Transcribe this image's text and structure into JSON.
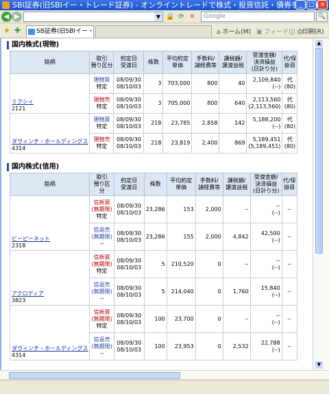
{
  "window": {
    "title": "SBI証券(旧SBIイー・トレード証券) - オンライントレードで株式・投資信託・債券を - Win..."
  },
  "nav": {
    "address": "",
    "search_placeholder": "Google"
  },
  "tabs": {
    "active": "SB証券(旧SBIイー・トレ...",
    "second": "",
    "home": "ホーム(M)",
    "feed": "フィード(J)",
    "print": "印刷(R)"
  },
  "genbutsu": {
    "title": "国内株式(現物)",
    "headers": [
      "銘柄",
      "取引\n預り区分",
      "約定日\n受渡日",
      "株数",
      "平均約定\n単価",
      "手数料/\n諸経費等",
      "課税額/\n譲渡益税",
      "受渡金額/\n決済損益\n(日計り分)",
      "代/保\n掛目"
    ],
    "rows": [
      {
        "name": "ミクシィ",
        "code": "2121",
        "side": "現物買",
        "sub": "特定",
        "trade": "08/09/30",
        "settle": "08/10/03",
        "qty": "3",
        "price": "703,000",
        "fee": "800",
        "tax": "40",
        "amount": "2,109,840",
        "pl": "(--)",
        "dai": "代",
        "kake": "(80)"
      },
      {
        "name": "",
        "code": "",
        "side": "現物売",
        "sub": "特定",
        "trade": "08/09/30",
        "settle": "08/10/03",
        "qty": "3",
        "price": "705,000",
        "fee": "800",
        "tax": "640",
        "amount": "2,113,560",
        "pl": "(2,113,560)",
        "dai": "代",
        "kake": "(80)"
      },
      {
        "name": "ダヴィンチ・ホールディングス",
        "code": "4314",
        "side": "現物買",
        "sub": "特定",
        "trade": "08/09/30",
        "settle": "08/10/03",
        "qty": "218",
        "price": "23,785",
        "fee": "2,858",
        "tax": "142",
        "amount": "5,188,200",
        "pl": "(--)",
        "dai": "代",
        "kake": "(80)"
      },
      {
        "name": "",
        "code": "",
        "side": "現物売",
        "sub": "特定",
        "trade": "08/09/30",
        "settle": "08/10/03",
        "qty": "218",
        "price": "23,819",
        "fee": "2,400",
        "tax": "869",
        "amount": "5,189,451",
        "pl": "(5,189,451)",
        "dai": "代",
        "kake": "(80)"
      }
    ]
  },
  "shinyo": {
    "title": "国内株式(信用)",
    "headers": [
      "銘柄",
      "取引\n預り区\n分",
      "約定日\n受渡日",
      "株数",
      "平均約定\n単価",
      "手数料/\n諸経費等",
      "課税額/\n譲渡益税",
      "受渡金額/\n決済損益\n(日計り分)",
      "代/保\n掛目"
    ],
    "rows": [
      {
        "name": "ビーピーネット",
        "code": "2318",
        "side": "信新買",
        "kind": "(無期限)",
        "sub": "特定",
        "trade": "08/09/30",
        "settle": "08/10/03",
        "qty": "23,286",
        "price": "153",
        "fee": "2,000",
        "tax": "--",
        "amount": "--",
        "pl": "(--)",
        "kake": "--"
      },
      {
        "name": "",
        "code": "",
        "side": "信返売",
        "kind": "(無期限)",
        "sub": "--",
        "trade": "08/09/30",
        "settle": "08/10/03",
        "qty": "23,286",
        "price": "155",
        "fee": "2,000",
        "tax": "4,842",
        "amount": "42,500",
        "pl": "(--)",
        "kake": "--"
      },
      {
        "name": "アクロディア",
        "code": "3823",
        "side": "信新買",
        "kind": "(無期限)",
        "sub": "特定",
        "trade": "08/09/30",
        "settle": "08/10/03",
        "qty": "5",
        "price": "210,520",
        "fee": "0",
        "tax": "--",
        "amount": "--",
        "pl": "(--)",
        "kake": "--"
      },
      {
        "name": "",
        "code": "",
        "side": "信返売",
        "kind": "(無期限)",
        "sub": "--",
        "trade": "08/09/30",
        "settle": "08/10/03",
        "qty": "5",
        "price": "214,040",
        "fee": "0",
        "tax": "1,760",
        "amount": "15,840",
        "pl": "(--)",
        "kake": "--"
      },
      {
        "name": "ダヴィンチ・ホールディングス",
        "code": "4314",
        "side": "信新買",
        "kind": "(無期限)",
        "sub": "特定",
        "trade": "08/09/30",
        "settle": "08/10/03",
        "qty": "100",
        "price": "23,700",
        "fee": "0",
        "tax": "--",
        "amount": "--",
        "pl": "(--)",
        "kake": "--"
      },
      {
        "name": "",
        "code": "",
        "side": "信返売",
        "kind": "(無期限)",
        "sub": "--",
        "trade": "08/09/30",
        "settle": "08/10/03",
        "qty": "100",
        "price": "23,953",
        "fee": "0",
        "tax": "2,532",
        "amount": "22,788",
        "pl": "(--)",
        "kake": "--"
      }
    ]
  }
}
